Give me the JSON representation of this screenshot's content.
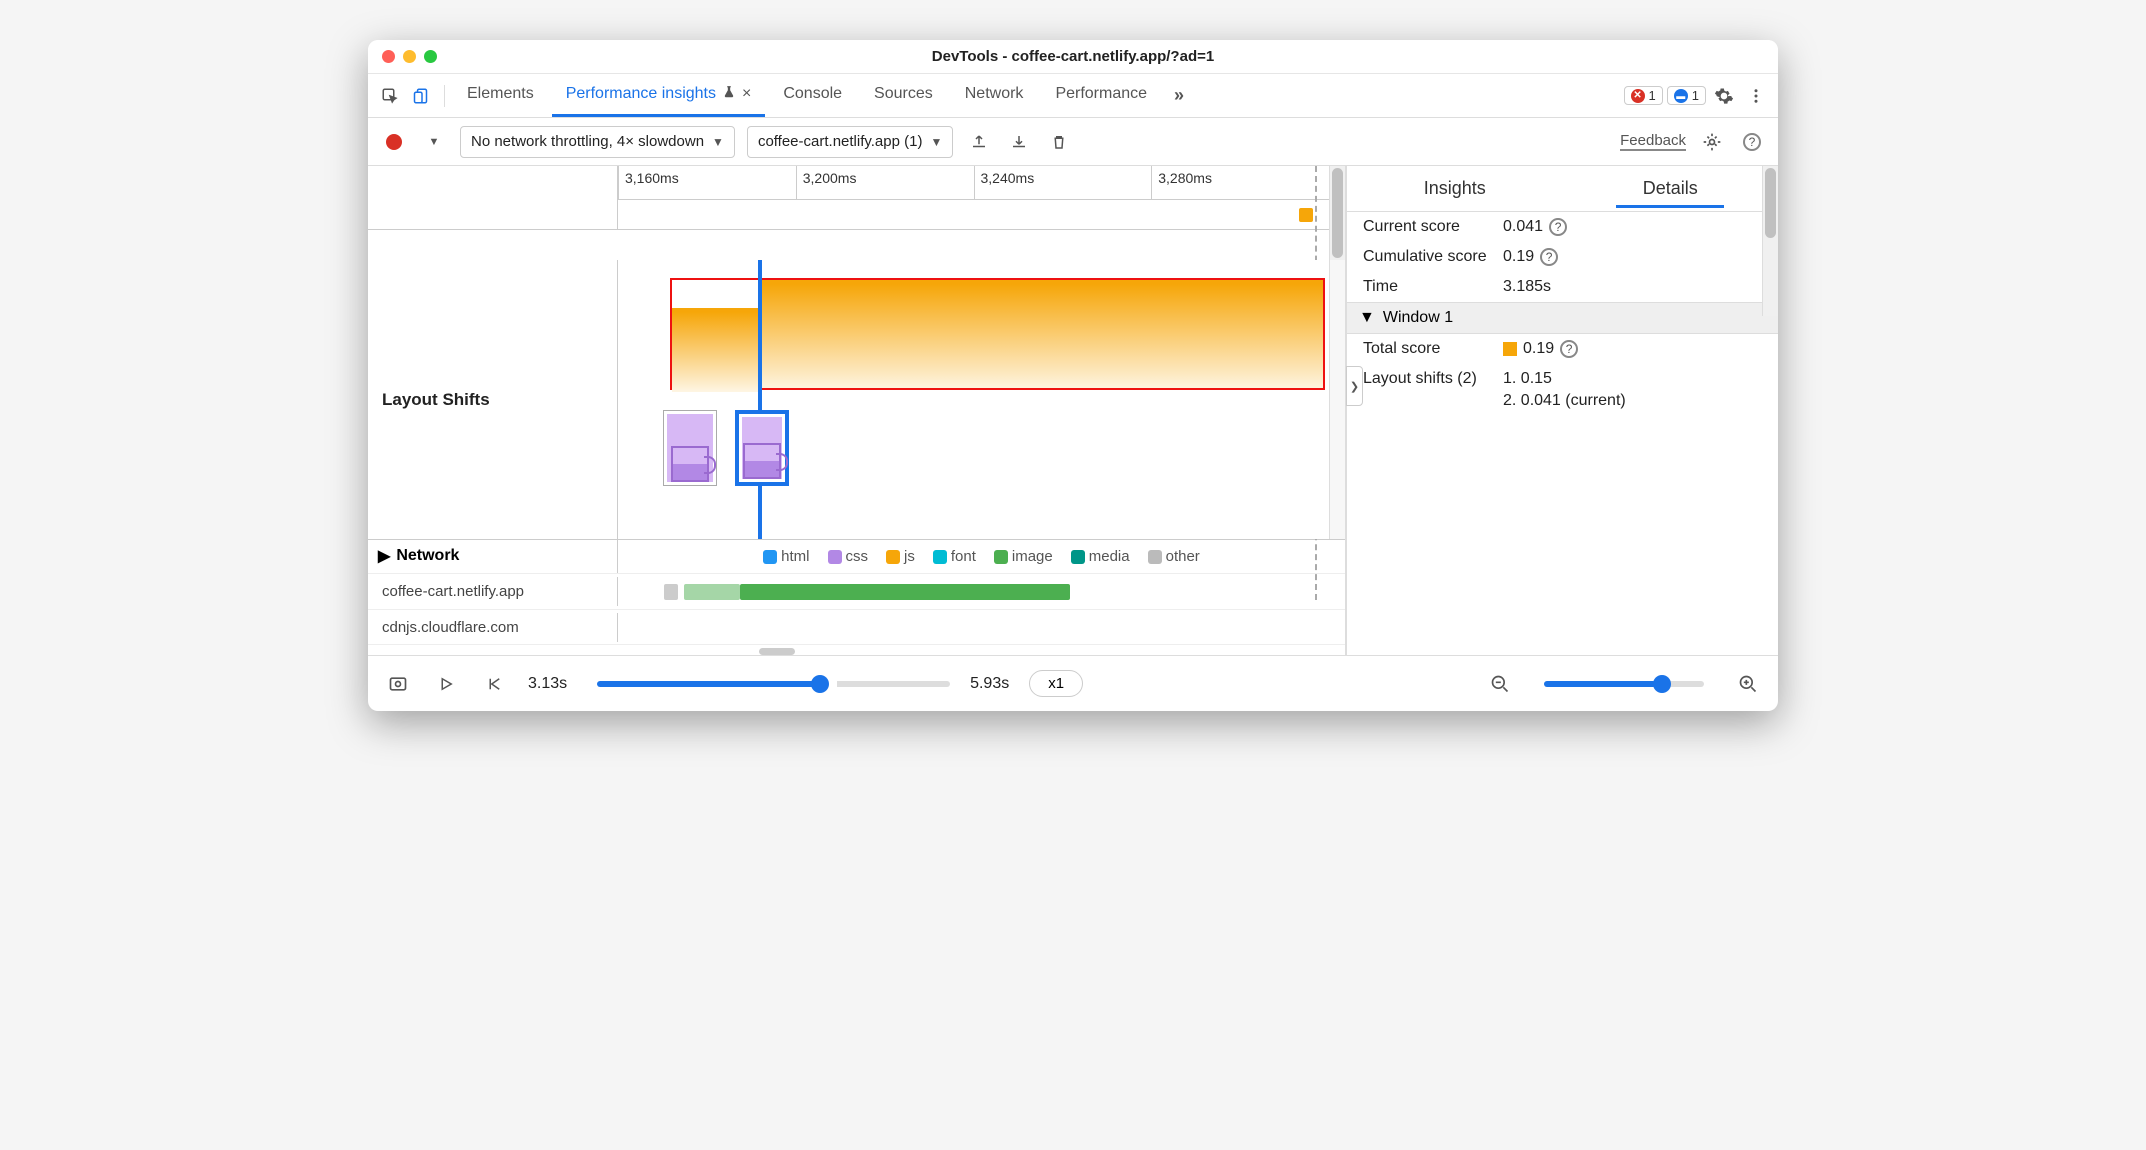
{
  "window": {
    "title": "DevTools - coffee-cart.netlify.app/?ad=1"
  },
  "tabs": {
    "elements": "Elements",
    "perf_insights": "Performance insights",
    "console": "Console",
    "sources": "Sources",
    "network": "Network",
    "performance": "Performance"
  },
  "badges": {
    "errors": "1",
    "messages": "1"
  },
  "toolbar": {
    "throttle": "No network throttling, 4× slowdown",
    "recording": "coffee-cart.netlify.app (1)",
    "feedback": "Feedback"
  },
  "ruler": {
    "ticks": [
      "3,160ms",
      "3,200ms",
      "3,240ms",
      "3,280ms"
    ]
  },
  "rows": {
    "layout_shifts": "Layout Shifts",
    "network": "Network"
  },
  "legend": {
    "html": "html",
    "css": "css",
    "js": "js",
    "font": "font",
    "image": "image",
    "media": "media",
    "other": "other"
  },
  "network_rows": {
    "domain1": "coffee-cart.netlify.app",
    "domain2": "cdnjs.cloudflare.com"
  },
  "footer": {
    "start": "3.13s",
    "end": "5.93s",
    "rate": "x1"
  },
  "side": {
    "tabs": {
      "insights": "Insights",
      "details": "Details"
    },
    "current_score_label": "Current score",
    "current_score_value": "0.041",
    "cumulative_score_label": "Cumulative score",
    "cumulative_score_value": "0.19",
    "time_label": "Time",
    "time_value": "3.185s",
    "window_label": "Window 1",
    "total_score_label": "Total score",
    "total_score_value": "0.19",
    "layout_shifts_label": "Layout shifts (2)",
    "shift1": "1. 0.15",
    "shift2": "2. 0.041 (current)"
  }
}
